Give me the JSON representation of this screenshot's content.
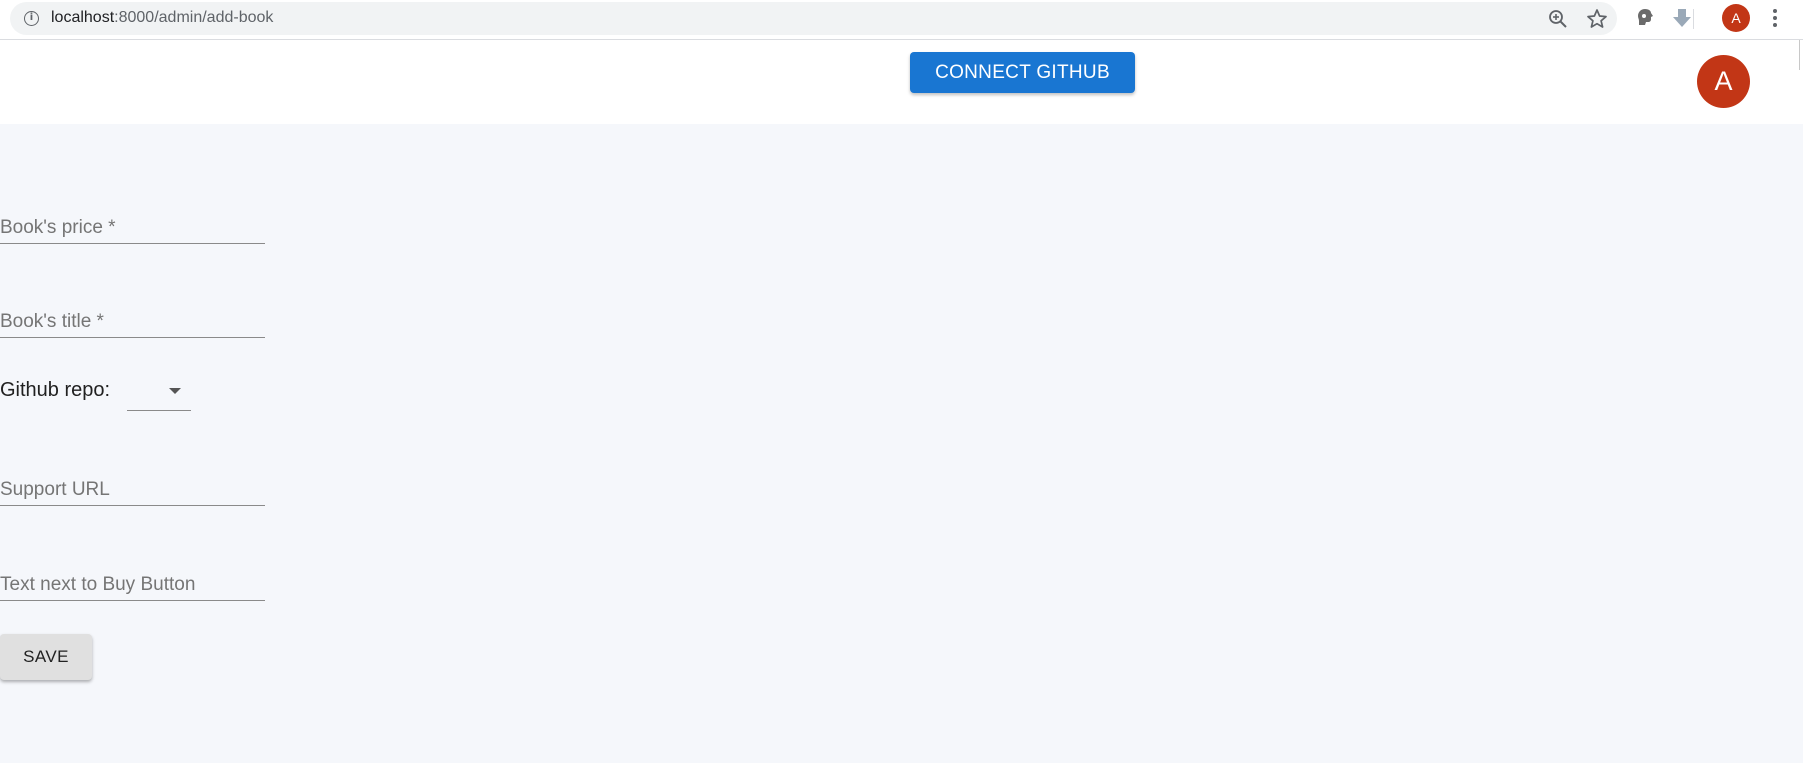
{
  "browser": {
    "url_host": "localhost",
    "url_path": ":8000/admin/add-book",
    "profile_initial": "A",
    "icons": [
      "info-icon",
      "zoom-icon",
      "star-icon",
      "extension-icon",
      "download-icon",
      "menu-icon"
    ]
  },
  "header": {
    "connect_label": "CONNECT GITHUB",
    "avatar_initial": "A"
  },
  "form": {
    "price_placeholder": "Book's price *",
    "title_placeholder": "Book's title *",
    "repo_label": "Github repo:",
    "support_placeholder": "Support URL",
    "buy_text_placeholder": "Text next to Buy Button",
    "save_label": "SAVE"
  },
  "colors": {
    "primary": "#1976d2",
    "avatar": "#c23616",
    "background": "#f5f7fb"
  }
}
